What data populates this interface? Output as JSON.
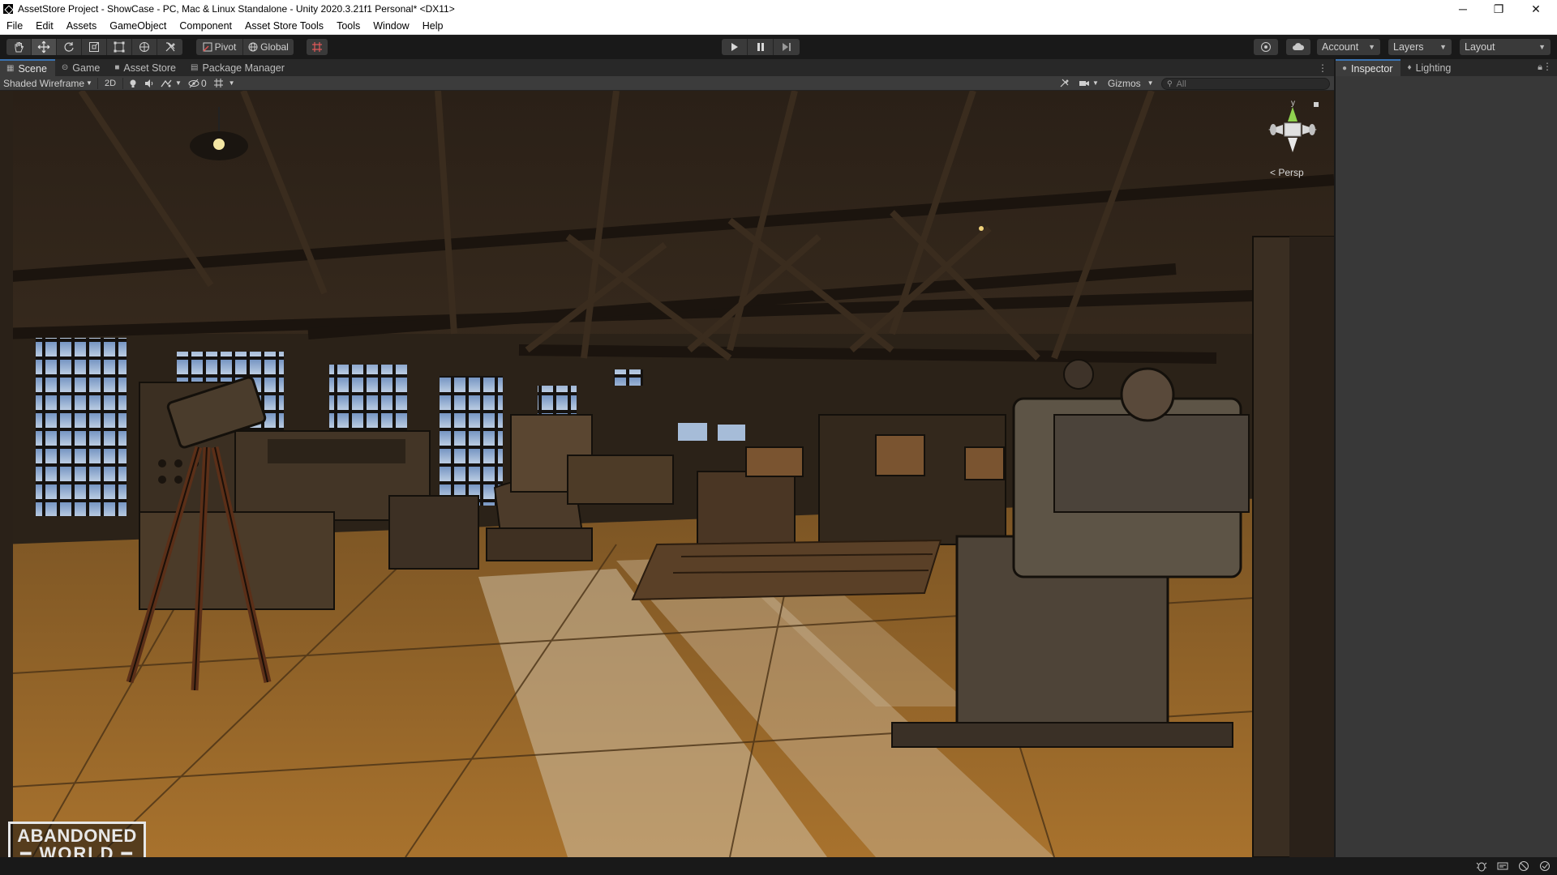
{
  "window": {
    "title": "AssetStore Project - ShowCase - PC, Mac & Linux Standalone - Unity 2020.3.21f1 Personal* <DX11>",
    "controls": {
      "minimize": "─",
      "maximize": "❐",
      "close": "✕"
    }
  },
  "menubar": [
    "File",
    "Edit",
    "Assets",
    "GameObject",
    "Component",
    "Asset Store Tools",
    "Tools",
    "Window",
    "Help"
  ],
  "toolbar": {
    "tools": [
      "hand-tool",
      "move-tool",
      "rotate-tool",
      "scale-tool",
      "rect-tool",
      "transform-tool",
      "custom-tool"
    ],
    "active_tool": "move-tool",
    "pivot_label": "Pivot",
    "global_label": "Global",
    "account_label": "Account",
    "layers_label": "Layers",
    "layout_label": "Layout"
  },
  "tabs": {
    "left": [
      {
        "label": "Scene",
        "icon": "grid-icon",
        "active": true
      },
      {
        "label": "Game",
        "icon": "gamepad-icon",
        "active": false
      },
      {
        "label": "Asset Store",
        "icon": "bag-icon",
        "active": false
      },
      {
        "label": "Package Manager",
        "icon": "package-icon",
        "active": false
      }
    ],
    "right": [
      {
        "label": "Inspector",
        "icon": "info-icon",
        "active": true
      },
      {
        "label": "Lighting",
        "icon": "bulb-icon",
        "active": false
      }
    ]
  },
  "scene_toolbar": {
    "draw_mode": "Shaded Wireframe",
    "mode_2d": "2D",
    "hidden_count": "0",
    "gizmos_label": "Gizmos",
    "search_placeholder": "All"
  },
  "viewport": {
    "projection_label": "< Persp",
    "gizmo_axis_label": "y",
    "logo_line1": "ABANDONED",
    "logo_line2": "━ WORLD ━"
  },
  "colors": {
    "chrome": "#191919",
    "panel": "#383838",
    "tab_active": "#3c3c3c",
    "accent": "#3a72b0",
    "gizmo_y": "#8fd14f",
    "gizmo_x": "#e04b4b"
  }
}
